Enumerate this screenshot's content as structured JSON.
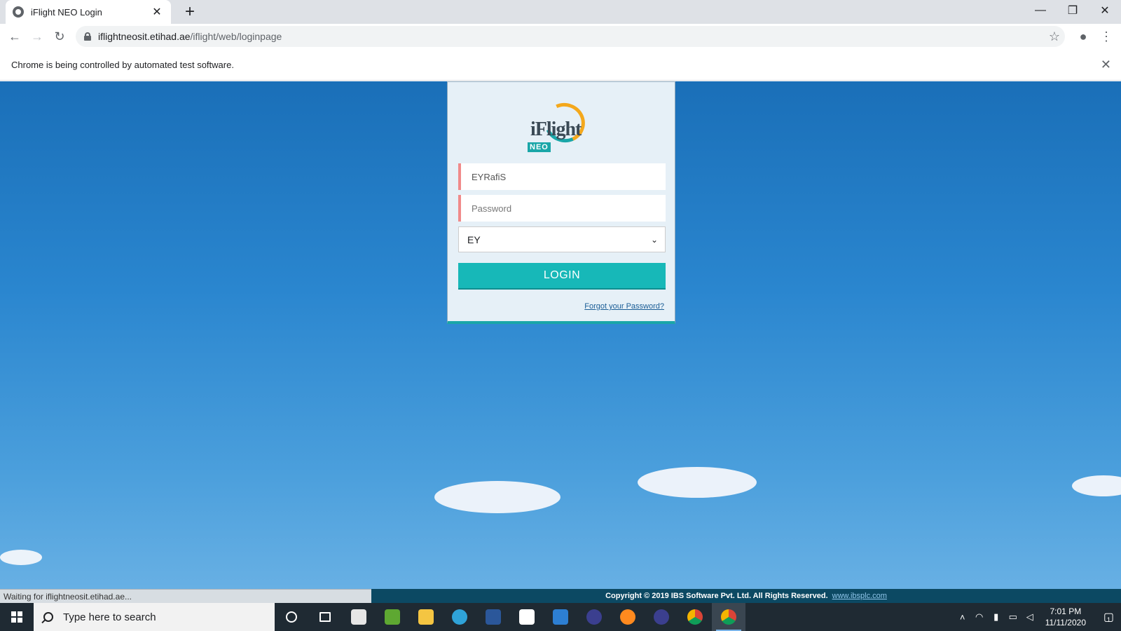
{
  "browser": {
    "tab_title": "iFlight NEO Login",
    "url_host": "iflightneosit.etihad.ae",
    "url_path": "/iflight/web/loginpage",
    "infobar_text": "Chrome is being controlled by automated test software."
  },
  "login": {
    "logo_text": "iFlight",
    "logo_badge": "NEO",
    "username_value": "EYRafiS",
    "password_placeholder": "Password",
    "airline_selected": "EY",
    "login_label": "LOGIN",
    "forgot_label": "Forgot your Password?"
  },
  "status_text": "Waiting for iflightneosit.etihad.ae...",
  "footer": {
    "copyright": "Copyright © 2019 IBS Software Pvt. Ltd. All Rights Reserved.",
    "link": "www.ibsplc.com"
  },
  "taskbar": {
    "search_placeholder": "Type here to search",
    "time": "7:01 PM",
    "date": "11/11/2020",
    "notification_count": "1"
  },
  "colors": {
    "accent": "#17b8b8",
    "field_marker": "#f08a8a",
    "footer_bg": "#0c4963"
  }
}
